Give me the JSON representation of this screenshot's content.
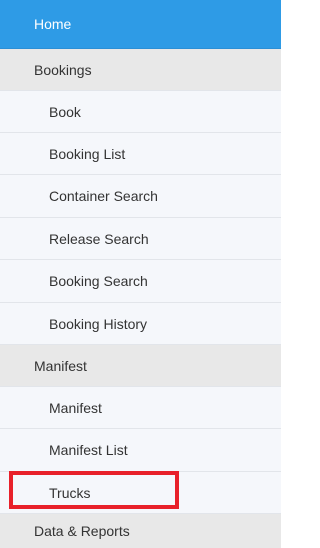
{
  "menu": {
    "home": "Home",
    "bookings": {
      "label": "Bookings",
      "items": [
        "Book",
        "Booking List",
        "Container Search",
        "Release Search",
        "Booking Search",
        "Booking History"
      ]
    },
    "manifest": {
      "label": "Manifest",
      "items": [
        "Manifest",
        "Manifest List",
        "Trucks"
      ]
    },
    "data_reports": "Data & Reports"
  },
  "colors": {
    "active": "#2e9be6",
    "section_bg": "#e8e8e8",
    "item_bg": "#f5f7fb",
    "highlight_border": "#e8202a"
  }
}
